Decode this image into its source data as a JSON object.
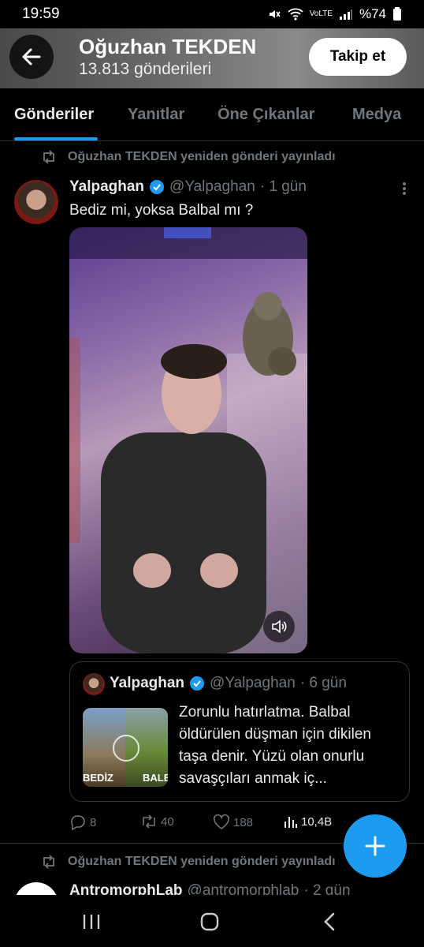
{
  "status": {
    "time": "19:59",
    "battery": "%74",
    "network": "VoLTE"
  },
  "header": {
    "title": "Oğuzhan TEKDEN",
    "subtitle": "13.813 gönderileri",
    "follow_label": "Takip et"
  },
  "tabs": [
    {
      "label": "Gönderiler",
      "active": true
    },
    {
      "label": "Yanıtlar",
      "active": false
    },
    {
      "label": "Öne Çıkanlar",
      "active": false
    },
    {
      "label": "Medya",
      "active": false
    }
  ],
  "tweet1": {
    "repost_text": "Oğuzhan TEKDEN yeniden gönderi yayınladı",
    "name": "Yalpaghan",
    "handle": "@Yalpaghan",
    "time": "· 1 gün",
    "text": "Bediz mi, yoksa Balbal mı ?",
    "quote": {
      "name": "Yalpaghan",
      "handle": "@Yalpaghan",
      "time": "· 6 gün",
      "text": "Zorunlu hatırlatma. Balbal öldürülen düşman için dikilen taşa denir. Yüzü olan onurlu savaşçıları anmak iç...",
      "thumb_left": "BEDİZ",
      "thumb_right": "BALBAL"
    },
    "actions": {
      "replies": "8",
      "reposts": "40",
      "likes": "188",
      "views": "10,4B"
    }
  },
  "tweet2": {
    "repost_text": "Oğuzhan TEKDEN yeniden gönderi yayınladı",
    "name": "AntromorphLab",
    "handle": "@antromorphlab",
    "time": "· 2 gün"
  },
  "colors": {
    "accent": "#1d9bf0",
    "muted": "#71767b",
    "background": "#000000"
  },
  "icons": [
    "back-arrow-icon",
    "verified-icon",
    "more-icon",
    "volume-icon",
    "reply-icon",
    "repost-icon",
    "like-icon",
    "views-icon",
    "plus-icon",
    "recents-icon",
    "home-icon",
    "back-nav-icon"
  ]
}
